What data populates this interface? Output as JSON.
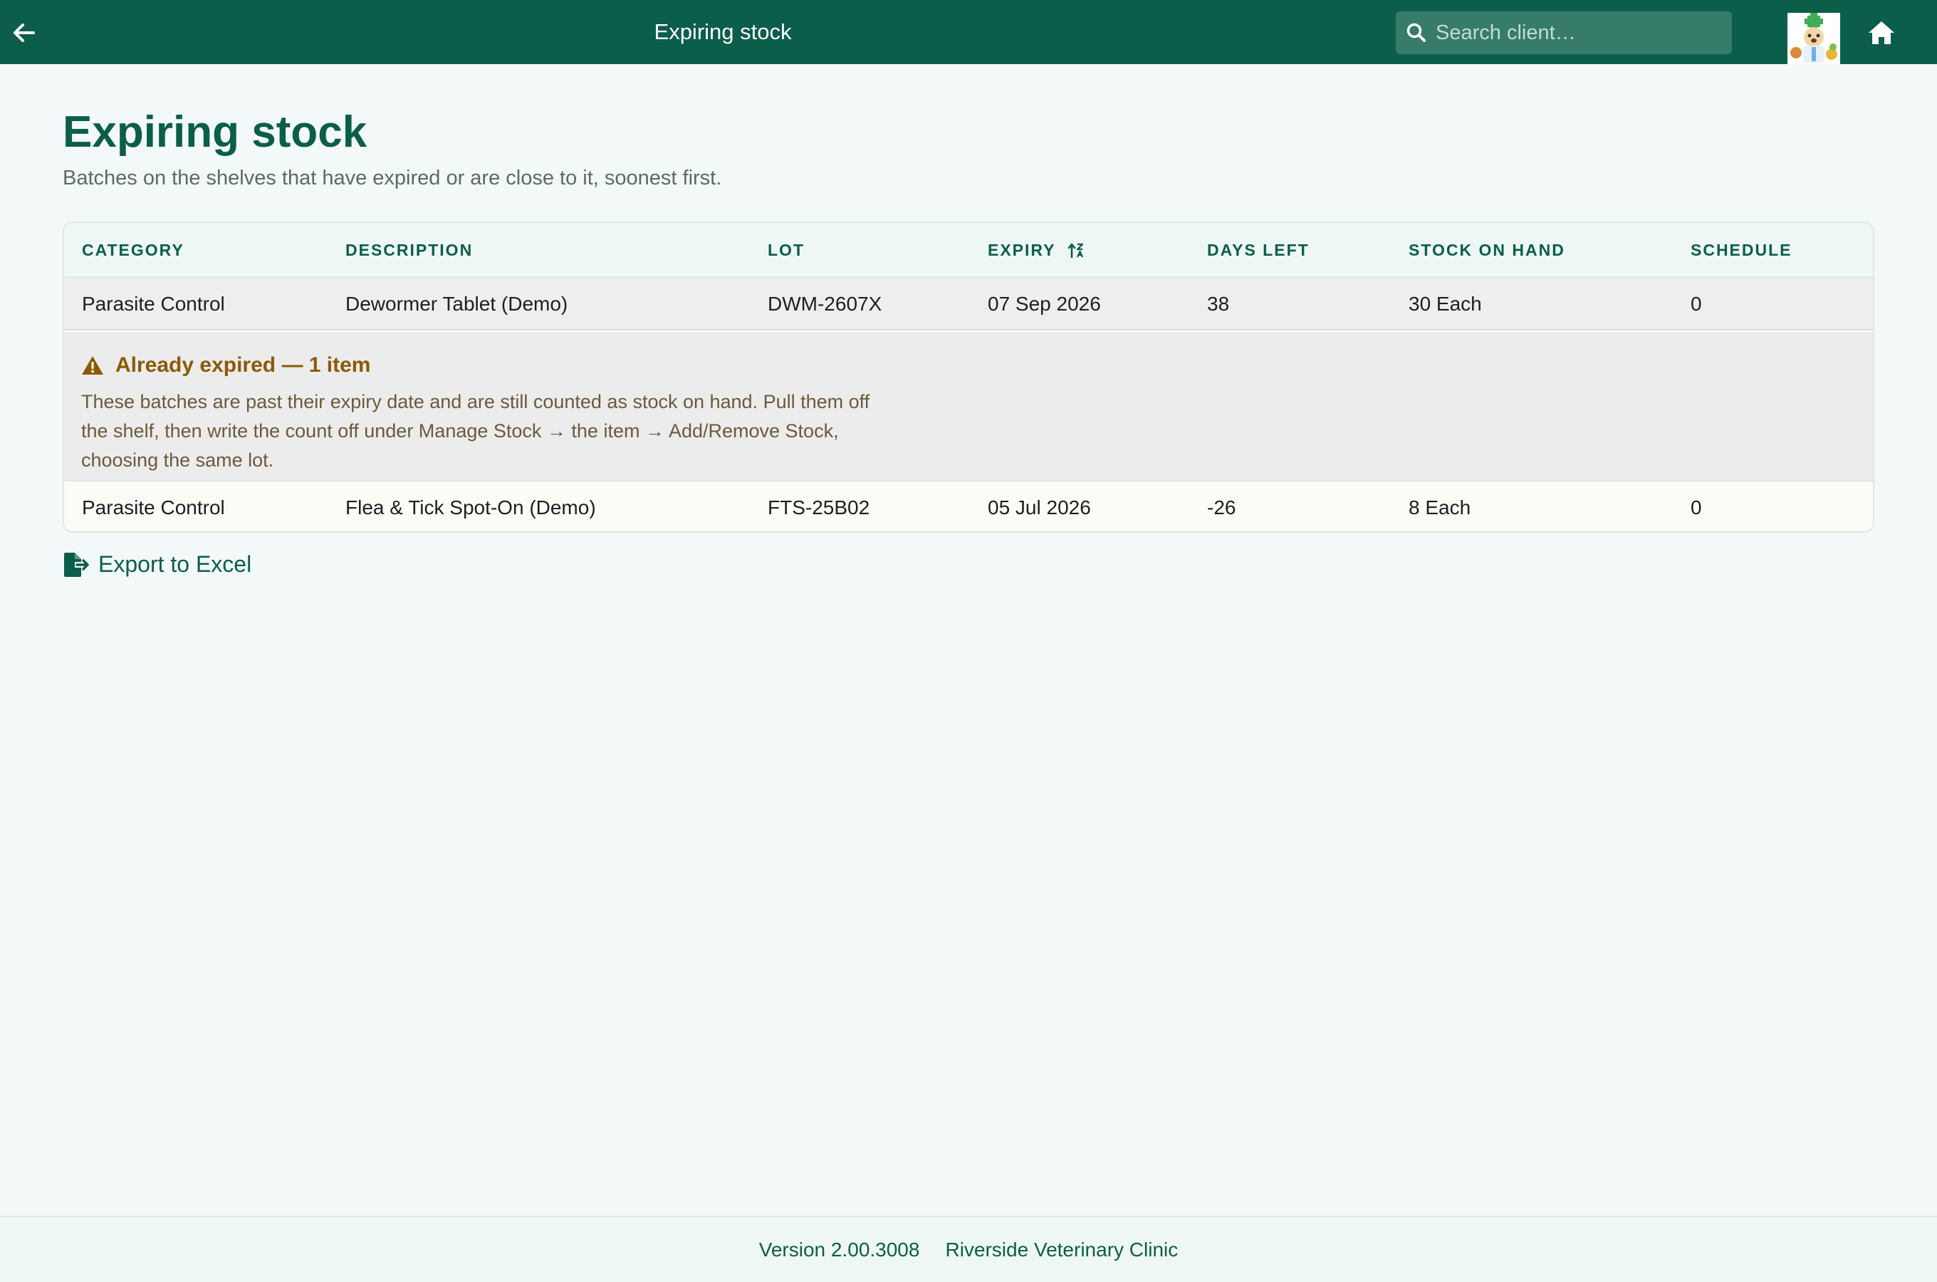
{
  "topbar": {
    "title": "Expiring stock",
    "search_placeholder": "Search client…",
    "back_icon": "arrow-left-icon",
    "home_icon": "home-icon",
    "accent_color": "#0b5e4a"
  },
  "page": {
    "title": "Expiring stock",
    "subtitle": "Batches on the shelves that have expired or are close to it, soonest first."
  },
  "table": {
    "columns": [
      "CATEGORY",
      "DESCRIPTION",
      "LOT",
      "EXPIRY",
      "DAYS LEFT",
      "STOCK ON HAND",
      "SCHEDULE"
    ],
    "sorted_column": "EXPIRY",
    "rows": [
      {
        "category": "Parasite Control",
        "description": "Dewormer Tablet (Demo)",
        "lot": "DWM-2607X",
        "expiry": "07 Sep 2026",
        "days_left": "38",
        "stock_on_hand": "30 Each",
        "schedule": "0"
      }
    ],
    "expired_group": {
      "heading": "Already expired — 1 item",
      "note": "These batches are past their expiry date and are still counted as stock on hand. Pull them off the shelf, then write the count off under Manage Stock → the item → Add/Remove Stock, choosing the same lot.",
      "status_color": "#8b5a07",
      "rows": [
        {
          "category": "Parasite Control",
          "description": "Flea & Tick Spot-On (Demo)",
          "lot": "FTS-25B02",
          "expiry": "05 Jul 2026",
          "days_left": "-26",
          "stock_on_hand": "8 Each",
          "schedule": "0"
        }
      ]
    }
  },
  "actions": {
    "export_label": "Export to Excel",
    "export_icon": "file-export-icon"
  },
  "footer": {
    "version": "Version 2.00.3008",
    "clinic": "Riverside Veterinary Clinic"
  }
}
